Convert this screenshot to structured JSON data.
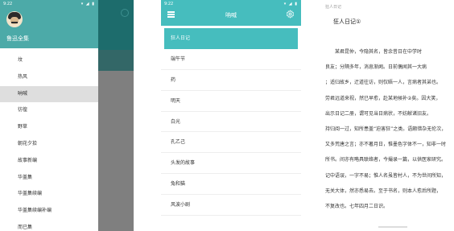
{
  "drawer": {
    "status_time": "9:22",
    "status_icons": "▾ ◢ ▮",
    "app_name": "鲁迅全集",
    "items": [
      {
        "label": "坟"
      },
      {
        "label": "热风"
      },
      {
        "label": "呐喊",
        "active": true
      },
      {
        "label": "彷徨"
      },
      {
        "label": "野草"
      },
      {
        "label": "朝花夕拾"
      },
      {
        "label": "故事新编"
      },
      {
        "label": "华盖集"
      },
      {
        "label": "华盖集续编"
      },
      {
        "label": "华盖集续编补编"
      },
      {
        "label": "而已集"
      }
    ]
  },
  "list_screen": {
    "status_time": "9:22",
    "status_icons": "▾ ◢ ▮",
    "title": "呐喊",
    "chapters": [
      {
        "label": "狂人日记",
        "active": true
      },
      {
        "label": "端午节"
      },
      {
        "label": "药"
      },
      {
        "label": "明天"
      },
      {
        "label": "白光"
      },
      {
        "label": "孔乙己"
      },
      {
        "label": "头发的故事"
      },
      {
        "label": "兔和猫"
      },
      {
        "label": "风波小剧"
      }
    ]
  },
  "reader": {
    "breadcrumb": "狂人日记",
    "chapter_title": "狂人日记①",
    "lines": [
      "　　某君昆仲，今隐其名，皆余昔日在中学时",
      "良友；分隔多年，消息渐阙。日前偶闻其一大病",
      "；适归故乡，迂道往访，则仅晤一人，言病者其弟也。",
      "劳君远道来视，然已早愈，赴某地候补②矣。因大笑，",
      "出示日记二册，谓可见当日病状，不妨献诸旧友。",
      "持归阅一过，知所患盖“迫害狂”之类。语颇错杂无伦次，",
      "又多荒唐之言；亦不著月日，惟墨色字体不一，知非一时",
      "所书。间亦有略具联络者，今撮录一篇，以供医家研究。",
      "记中语误，一字不易；惟人名虽皆村人，不为世间所知，",
      "无关大体，然亦悉易去。至于书名，则本人愈后所题，",
      "不复改也。七年四月二日识。"
    ]
  },
  "colors": {
    "accent": "#46bdbe",
    "drawer_header": "#4caaa8",
    "dim_overlay": "#7f7f7f"
  }
}
